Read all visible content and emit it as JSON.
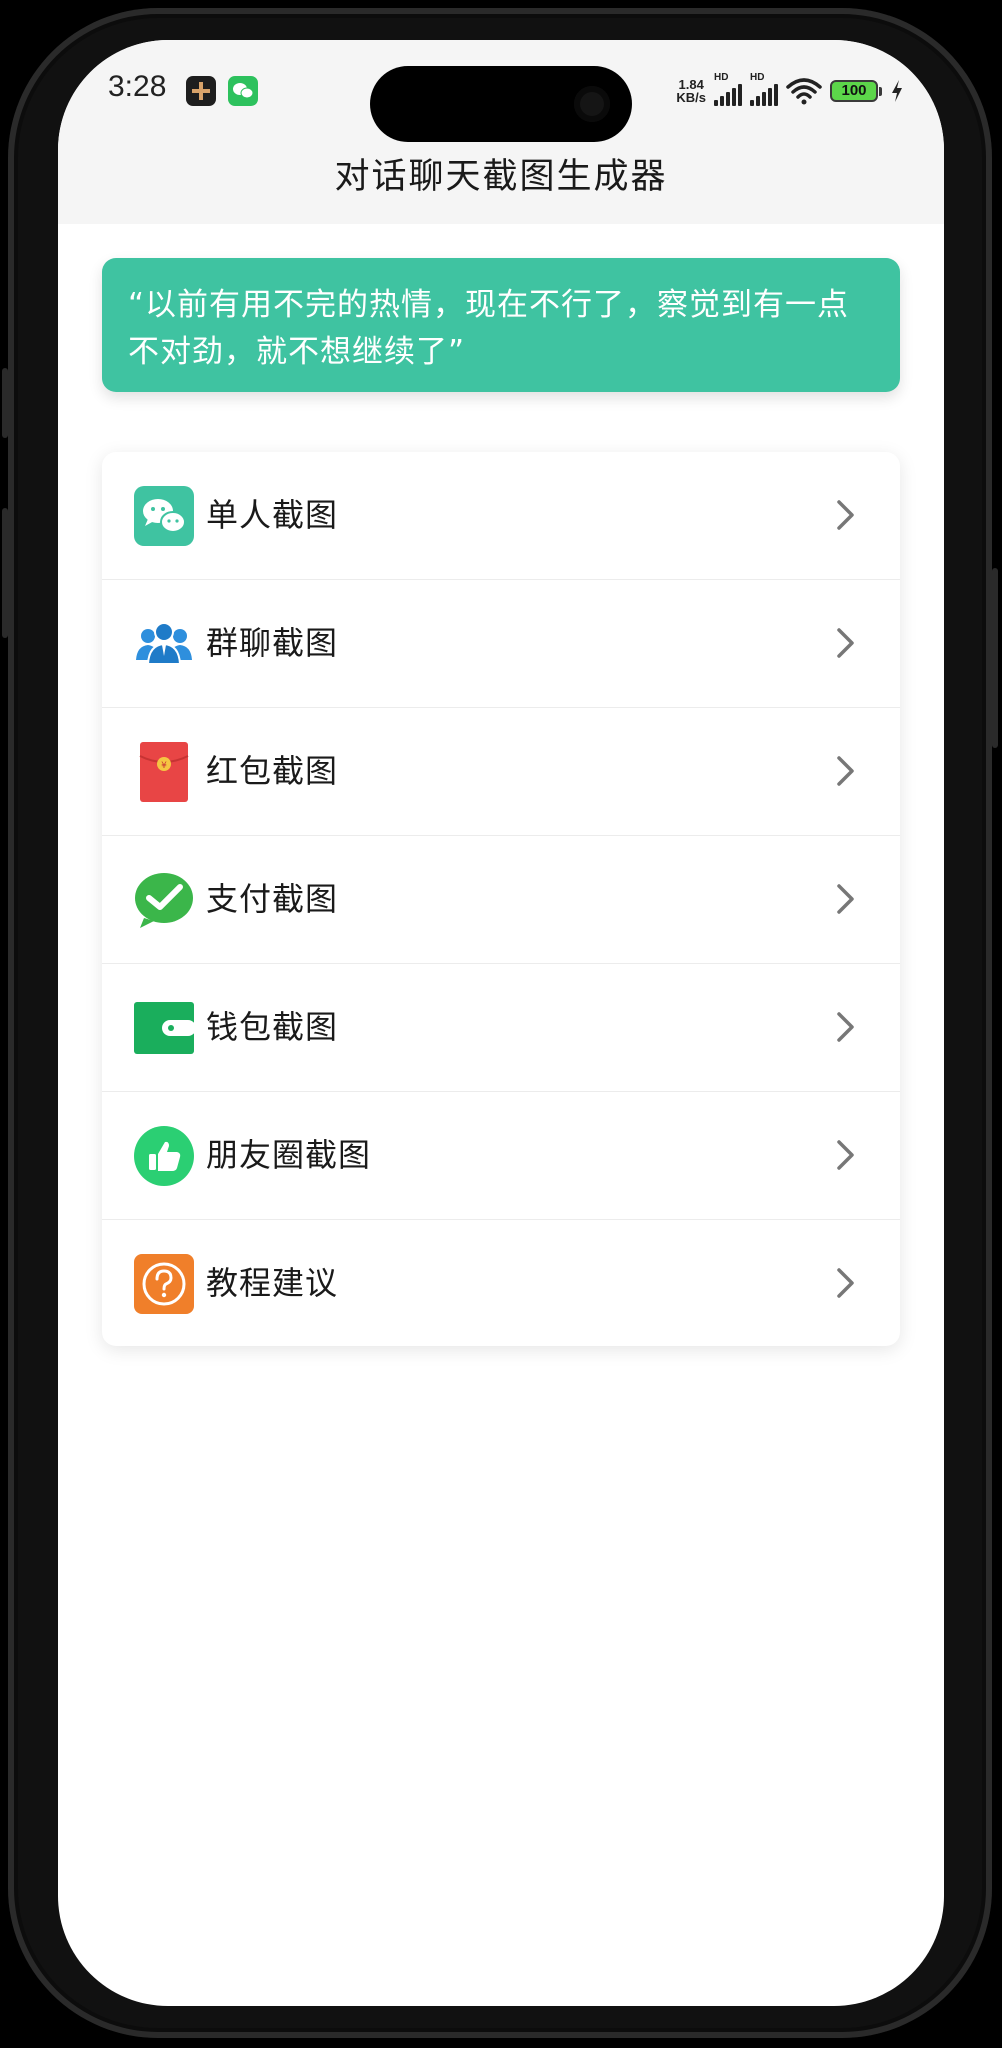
{
  "status_bar": {
    "time": "3:28",
    "net_speed_value": "1.84",
    "net_speed_unit": "KB/s",
    "signal_1_tag": "HD",
    "signal_2_tag": "HD",
    "battery_level": "100",
    "app_icons": [
      "recorder-app-icon",
      "wechat-app-icon"
    ]
  },
  "header": {
    "title": "对话聊天截图生成器"
  },
  "quote": {
    "text": "“以前有用不完的热情，现在不行了，察觉到有一点不对劲，就不想继续了”"
  },
  "menu": {
    "items": [
      {
        "label": "单人截图",
        "icon": "chat-bubbles-icon"
      },
      {
        "label": "群聊截图",
        "icon": "group-users-icon"
      },
      {
        "label": "红包截图",
        "icon": "red-envelope-icon"
      },
      {
        "label": "支付截图",
        "icon": "payment-check-icon"
      },
      {
        "label": "钱包截图",
        "icon": "wallet-icon"
      },
      {
        "label": "朋友圈截图",
        "icon": "thumbs-up-icon"
      },
      {
        "label": "教程建议",
        "icon": "question-mark-icon"
      }
    ]
  },
  "colors": {
    "accent_teal": "#3fc3a1",
    "header_bg": "#f5f5f5",
    "red_envelope": "#e84545",
    "wechat_green": "#3bb64a",
    "wallet_green": "#1aae5c",
    "moments_green": "#2bcf73",
    "help_orange": "#f07f2a",
    "group_blue": "#2e8fdd"
  }
}
